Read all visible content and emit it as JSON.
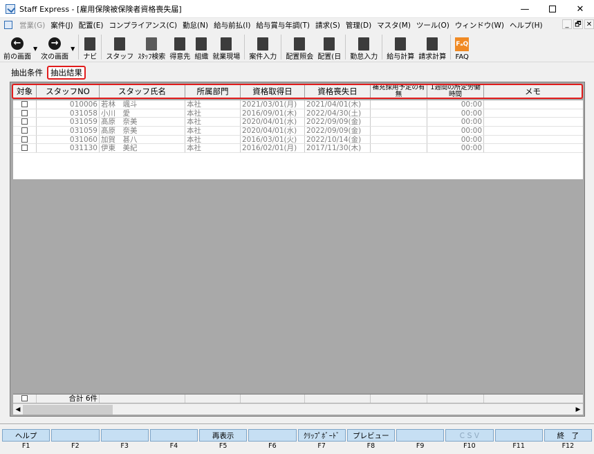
{
  "window": {
    "title": "Staff Express - [雇用保険被保険者資格喪失届]",
    "min_glyph": "—",
    "close_glyph": "✕"
  },
  "menu": [
    {
      "label": "営業(G)",
      "disabled": true
    },
    {
      "label": "案件(J)"
    },
    {
      "label": "配置(E)"
    },
    {
      "label": "コンプライアンス(C)"
    },
    {
      "label": "勤怠(N)"
    },
    {
      "label": "給与前払(I)"
    },
    {
      "label": "給与賞与年調(T)"
    },
    {
      "label": "請求(S)"
    },
    {
      "label": "管理(D)"
    },
    {
      "label": "マスタ(M)"
    },
    {
      "label": "ツール(O)"
    },
    {
      "label": "ウィンドウ(W)"
    },
    {
      "label": "ヘルプ(H)"
    }
  ],
  "mdi_controls": [
    "_",
    "🗗",
    "✕"
  ],
  "toolbar": {
    "prev": "前の画面",
    "next": "次の画面",
    "navi": "ナビ",
    "staff": "スタッフ",
    "staff_search": "ｽﾀｯﾌ検索",
    "client": "得意先",
    "org": "組織",
    "worksite": "就業現場",
    "case_input": "案件入力",
    "placement_query": "配置照会",
    "placement_day": "配置(日",
    "attendance_input": "勤怠入力",
    "salary_calc": "給与計算",
    "billing_calc": "請求計算",
    "faq": "FAQ",
    "faq_icon_text": "FₐQ"
  },
  "tabs": [
    {
      "label": "抽出条件",
      "active": false
    },
    {
      "label": "抽出結果",
      "active": true
    }
  ],
  "columns": [
    "対象",
    "スタッフNO",
    "スタッフ氏名",
    "所属部門",
    "資格取得日",
    "資格喪失日",
    "補充採用予定の有無",
    "1週間の所定労働時間",
    "メモ"
  ],
  "rows": [
    {
      "no": "010006",
      "name": "若林　颯斗",
      "dept": "本社",
      "acquired": "2021/03/01(月)",
      "lost": "2021/04/01(木)",
      "hours": "00:00"
    },
    {
      "no": "031058",
      "name": "小川　愛",
      "dept": "本社",
      "acquired": "2016/09/01(木)",
      "lost": "2022/04/30(土)",
      "hours": "00:00"
    },
    {
      "no": "031059",
      "name": "髙原　奈美",
      "dept": "本社",
      "acquired": "2020/04/01(水)",
      "lost": "2022/09/09(金)",
      "hours": "00:00"
    },
    {
      "no": "031059",
      "name": "髙原　奈美",
      "dept": "本社",
      "acquired": "2020/04/01(水)",
      "lost": "2022/09/09(金)",
      "hours": "00:00"
    },
    {
      "no": "031060",
      "name": "加賀　甚八",
      "dept": "本社",
      "acquired": "2016/03/01(火)",
      "lost": "2022/10/14(金)",
      "hours": "00:00"
    },
    {
      "no": "031130",
      "name": "伊東　美紀",
      "dept": "本社",
      "acquired": "2016/02/01(月)",
      "lost": "2017/11/30(木)",
      "hours": "00:00"
    }
  ],
  "footer": {
    "total_label": "合計",
    "total_count": "6件"
  },
  "fkeys": [
    {
      "label": "ヘルプ",
      "key": "F1"
    },
    {
      "label": "",
      "key": "F2"
    },
    {
      "label": "",
      "key": "F3"
    },
    {
      "label": "",
      "key": "F4"
    },
    {
      "label": "再表示",
      "key": "F5"
    },
    {
      "label": "",
      "key": "F6"
    },
    {
      "label": "ｸﾘｯﾌﾟﾎﾞｰﾄﾞ",
      "key": "F7"
    },
    {
      "label": "プレビュー",
      "key": "F8"
    },
    {
      "label": "",
      "key": "F9"
    },
    {
      "label": "ＣＳＶ",
      "key": "F10",
      "disabled": true
    },
    {
      "label": "",
      "key": "F11"
    },
    {
      "label": "終　了",
      "key": "F12"
    }
  ],
  "colors": {
    "highlight": "#e11b1b",
    "fkey_bg": "#c6dff3",
    "grid_empty": "#a9a9a9"
  }
}
